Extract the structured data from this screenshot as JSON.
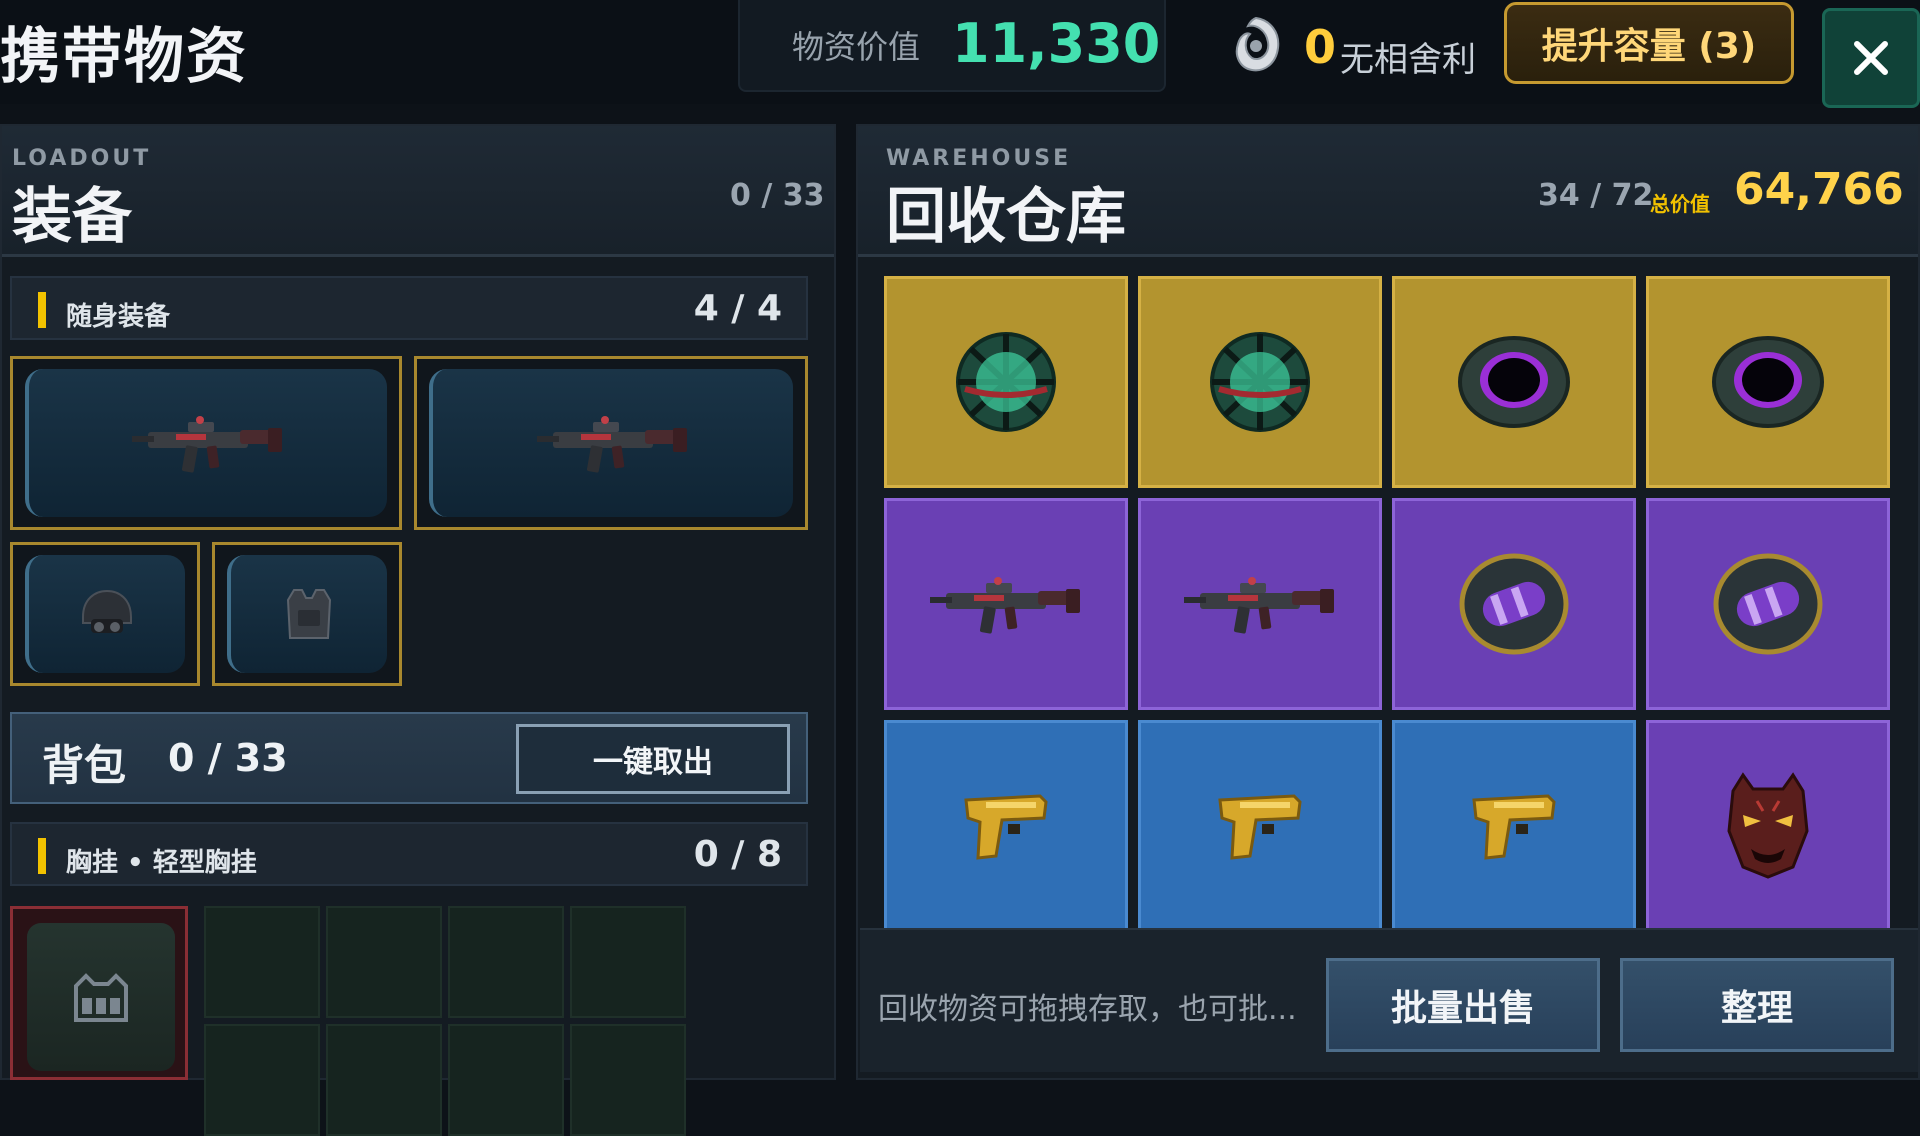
{
  "header": {
    "title": "携带物资",
    "value_label": "物资价值",
    "value": "11,330",
    "token_count": "0",
    "token_label": "无相舍利",
    "upgrade_label": "提升容量 (3)"
  },
  "loadout": {
    "sub": "LOADOUT",
    "title": "装备",
    "count": "0 / 33",
    "carry_label": "随身装备",
    "carry_count": "4 / 4",
    "backpack_label": "背包",
    "backpack_count": "0 / 33",
    "takeout_label": "一键取出",
    "vest_label": "胸挂 • 轻型胸挂",
    "vest_count": "0 / 8"
  },
  "warehouse": {
    "sub": "WAREHOUSE",
    "title": "回收仓库",
    "count": "34 / 72",
    "total_label": "总价值",
    "total_value": "64,766",
    "items": [
      {
        "rarity": "gold",
        "icon": "green-orb-icon"
      },
      {
        "rarity": "gold",
        "icon": "green-orb-icon"
      },
      {
        "rarity": "gold",
        "icon": "dark-portal-ring-icon"
      },
      {
        "rarity": "gold",
        "icon": "dark-portal-ring-icon"
      },
      {
        "rarity": "purple",
        "icon": "smg-rifle-icon"
      },
      {
        "rarity": "purple",
        "icon": "smg-rifle-icon"
      },
      {
        "rarity": "purple",
        "icon": "purple-capsule-icon"
      },
      {
        "rarity": "purple",
        "icon": "purple-capsule-icon"
      },
      {
        "rarity": "blue",
        "icon": "gold-pistol-icon"
      },
      {
        "rarity": "blue",
        "icon": "gold-pistol-icon"
      },
      {
        "rarity": "blue",
        "icon": "gold-pistol-icon"
      },
      {
        "rarity": "purple",
        "icon": "demon-mask-icon"
      }
    ],
    "hint": "回收物资可拖拽存取，也可批...",
    "bulk_sell_label": "批量出售",
    "sort_label": "整理"
  }
}
